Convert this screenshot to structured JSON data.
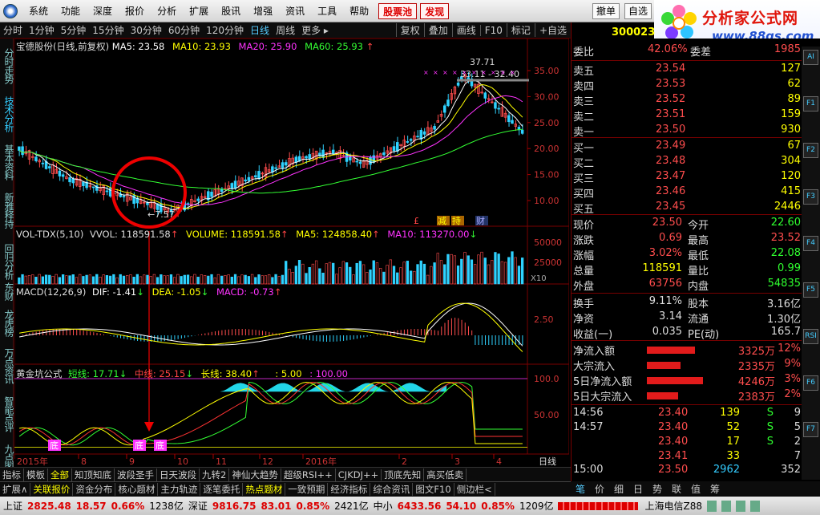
{
  "menu": {
    "items": [
      "系统",
      "功能",
      "深度",
      "报价",
      "分析",
      "扩展",
      "股讯",
      "增强",
      "资讯",
      "工具",
      "帮助"
    ],
    "hot1": "股票池",
    "hot2": "发现",
    "right1": "撤单",
    "right2": "自选"
  },
  "brand": {
    "title": "分析家公式网",
    "url": "www.88gs.com"
  },
  "periods": [
    "分时",
    "1分钟",
    "5分钟",
    "15分钟",
    "30分钟",
    "60分钟",
    "120分钟",
    "日线",
    "周线",
    "更多"
  ],
  "period_more_arrow": "▸",
  "tools": [
    "复权",
    "叠加",
    "画线",
    "F10",
    "标记",
    "+自选"
  ],
  "stock": {
    "code": "300023",
    "name": "宝德股份(日线,前复权)"
  },
  "leftnav": [
    "分时走势",
    "技术分析",
    "基本资料",
    "新雅释持",
    "回归分析",
    "东财",
    "龙虎榜",
    "万点资讯",
    "智能点评",
    "九点图"
  ],
  "main_legend": {
    "name": "宝德股份(日线,前复权)",
    "ma5": "MA5: 23.58",
    "ma10": "MA10: 23.93",
    "ma20": "MA20: 25.90",
    "ma60": "MA60: 25.93",
    "arrow": "↑"
  },
  "price_labels": {
    "high": "37.71",
    "range": "33.11 - 32.40",
    "low": "7.57",
    "low_prefix": "←"
  },
  "markers": {
    "m1": "减",
    "m2": "持",
    "m3": "财",
    "m4": "£"
  },
  "yaxis_main": [
    "35.00",
    "30.00",
    "25.00",
    "20.00",
    "15.00",
    "10.00"
  ],
  "vol_legend": {
    "name": "VOL-TDX(5,10)",
    "vvol": "VVOL: 118591.58",
    "volume": "VOLUME: 118591.58",
    "ma5": "MA5: 124858.40",
    "ma10": "MA10: 113270.00",
    "arrow": "↑",
    "down": "↓"
  },
  "yaxis_vol": [
    "50000",
    "25000"
  ],
  "vol_unit": "X10",
  "macd_legend": {
    "name": "MACD(12,26,9)",
    "dif": "DIF: -1.41",
    "dea": "DEA: -1.05",
    "macd": "MACD: -0.73",
    "up": "↑",
    "down": "↓"
  },
  "yaxis_macd": [
    "2.50"
  ],
  "gold_legend": {
    "name": "黄金坑公式",
    "short": "短线: 17.71",
    "mid": "中线: 25.15",
    "long": "长线: 38.40",
    "v1": ": 5.00",
    "v2": ": 100.00",
    "up": "↑",
    "down": "↓"
  },
  "yaxis_gold": [
    "100.0",
    "50.00"
  ],
  "gold_tags": {
    "t1": "底",
    "t2": "底",
    "t3": "底"
  },
  "xaxis": [
    "2015年",
    "8",
    "9",
    "10",
    "11",
    "12",
    "2016年",
    "2",
    "3",
    "4",
    "5"
  ],
  "xaxis_label": "日线",
  "orderbook": {
    "weibi_label": "委比",
    "weibi": "42.06%",
    "weicha_label": "委差",
    "weicha": "1985",
    "sells": [
      {
        "label": "卖五",
        "price": "23.54",
        "vol": "127"
      },
      {
        "label": "卖四",
        "price": "23.53",
        "vol": "62"
      },
      {
        "label": "卖三",
        "price": "23.52",
        "vol": "89"
      },
      {
        "label": "卖二",
        "price": "23.51",
        "vol": "159"
      },
      {
        "label": "卖一",
        "price": "23.50",
        "vol": "930"
      }
    ],
    "buys": [
      {
        "label": "买一",
        "price": "23.49",
        "vol": "67"
      },
      {
        "label": "买二",
        "price": "23.48",
        "vol": "304"
      },
      {
        "label": "买三",
        "price": "23.47",
        "vol": "120"
      },
      {
        "label": "买四",
        "price": "23.46",
        "vol": "415"
      },
      {
        "label": "买五",
        "price": "23.45",
        "vol": "2446"
      }
    ]
  },
  "quote": [
    {
      "l1": "现价",
      "v1": "23.50",
      "l2": "今开",
      "v2": "22.60",
      "c1": "red",
      "c2": "green"
    },
    {
      "l1": "涨跌",
      "v1": "0.69",
      "l2": "最高",
      "v2": "23.52",
      "c1": "red",
      "c2": "red"
    },
    {
      "l1": "涨幅",
      "v1": "3.02%",
      "l2": "最低",
      "v2": "22.08",
      "c1": "red",
      "c2": "green"
    },
    {
      "l1": "总量",
      "v1": "118591",
      "l2": "量比",
      "v2": "0.99",
      "c1": "yellow",
      "c2": "green"
    },
    {
      "l1": "外盘",
      "v1": "63756",
      "l2": "内盘",
      "v2": "54835",
      "c1": "red",
      "c2": "green"
    }
  ],
  "quote2": [
    {
      "l1": "换手",
      "v1": "9.11%",
      "l2": "股本",
      "v2": "3.16亿"
    },
    {
      "l1": "净资",
      "v1": "3.14",
      "l2": "流通",
      "v2": "1.30亿"
    },
    {
      "l1": "收益(一)",
      "v1": "0.035",
      "l2": "PE(动)",
      "v2": "165.7"
    }
  ],
  "flows": [
    {
      "label": "净流入额",
      "value": "3325万",
      "pct": "12%",
      "bar": 0.85
    },
    {
      "label": "大宗流入",
      "value": "2335万",
      "pct": "9%",
      "bar": 0.6
    },
    {
      "label": "5日净流入额",
      "value": "4246万",
      "pct": "3%",
      "bar": 1.0
    },
    {
      "label": "5日大宗流入",
      "value": "2383万",
      "pct": "2%",
      "bar": 0.55
    }
  ],
  "ticks": [
    {
      "time": "14:56",
      "price": "23.40",
      "vol": "139",
      "bs": "S",
      "n": "9"
    },
    {
      "time": "14:57",
      "price": "23.40",
      "vol": "52",
      "bs": "S",
      "n": "5"
    },
    {
      "time": "",
      "price": "23.40",
      "vol": "17",
      "bs": "S",
      "n": "2"
    },
    {
      "time": "",
      "price": "23.41",
      "vol": "33",
      "bs": "",
      "n": "7"
    },
    {
      "time": "15:00",
      "price": "23.50",
      "vol": "2962",
      "bs": "",
      "n": "352"
    }
  ],
  "bottomtabs": [
    "指标",
    "模板",
    "全部",
    "知顶知底",
    "波段圣手",
    "日天波段",
    "九转2",
    "神仙大趋势",
    "超级RSI++",
    "CJKDJ++",
    "顶底先知",
    "高买低卖",
    "扩展∧",
    "关联报价",
    "资金分布",
    "核心题材",
    "主力轨迹",
    "逐笔委托",
    "热点题材",
    "一致预期",
    "经济指标",
    "综合资讯",
    "图文F10",
    "侧边栏<"
  ],
  "rtabs": [
    "笔",
    "价",
    "细",
    "日",
    "势",
    "联",
    "值",
    "筹"
  ],
  "sidetools": [
    "AI",
    "F1",
    "F2",
    "F3",
    "F4",
    "F5",
    "RSI",
    "F6",
    "F7"
  ],
  "status": {
    "sh_label": "上证",
    "sh": "2825.48",
    "sh_chg": "18.57",
    "sh_pct": "0.66%",
    "sh_amt": "1238亿",
    "sz_label": "深证",
    "sz": "9816.75",
    "sz_chg": "83.01",
    "sz_pct": "0.85%",
    "sz_amt": "2421亿",
    "zx_label": "中小",
    "zx": "6433.56",
    "zx_chg": "54.10",
    "zx_pct": "0.85%",
    "zx_amt": "1209亿",
    "server": "上海电信Z88"
  },
  "colors": {
    "up": "#ff4d4d",
    "down": "#2fff2f",
    "ma5": "#ffffff",
    "ma10": "#ffff00",
    "ma20": "#ff33ff",
    "ma60": "#33ff33",
    "gold_fill": "#22d6e8"
  }
}
